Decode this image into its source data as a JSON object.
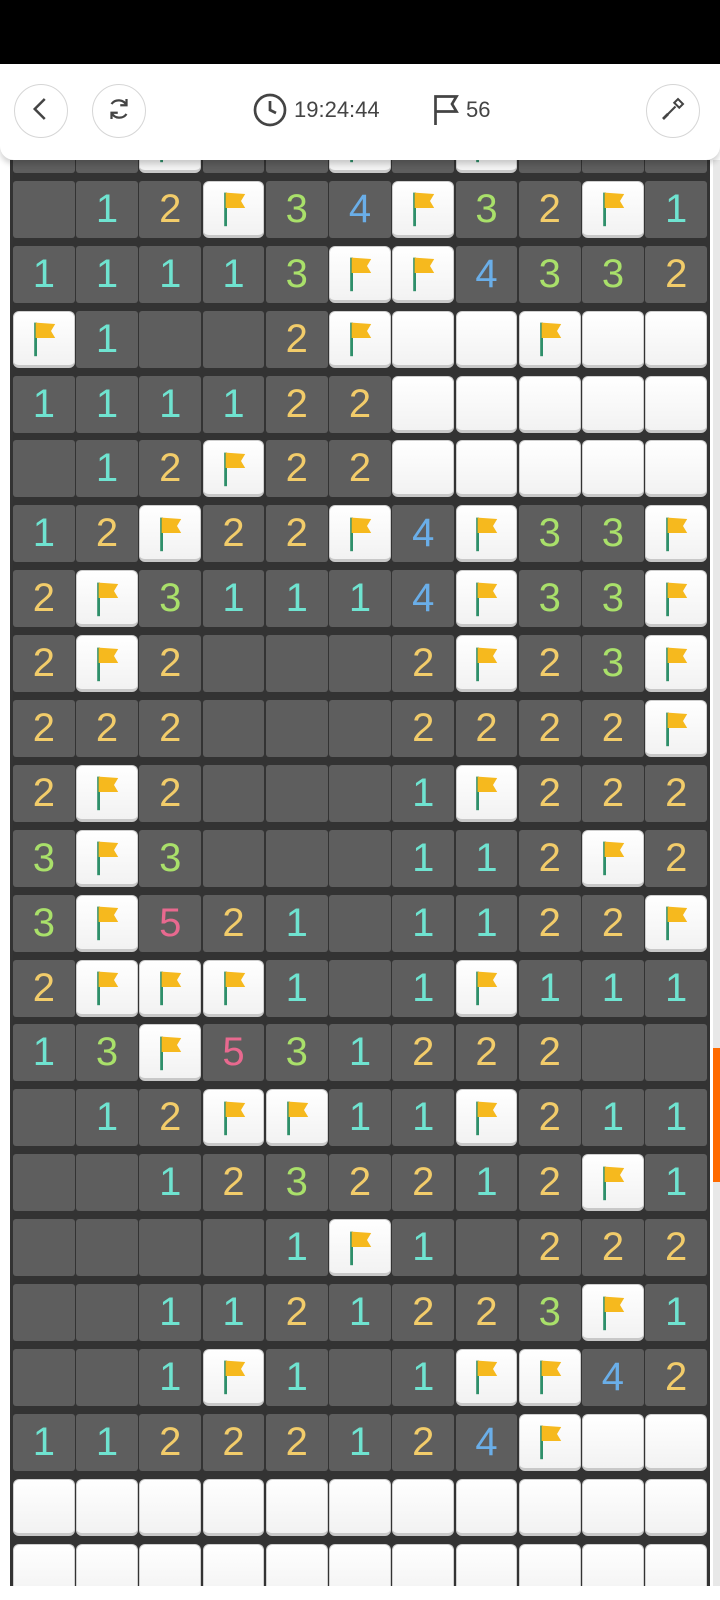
{
  "header": {
    "back_icon": "chevron-left-icon",
    "restart_icon": "refresh-icon",
    "timer": "19:24:44",
    "timer_icon": "clock-icon",
    "flags_remaining": "56",
    "flag_icon": "flag-outline-icon",
    "tool_icon": "shovel-icon"
  },
  "colors": {
    "n1": "#6fe3d0",
    "n2": "#f2cc6a",
    "n3": "#a9e06a",
    "n4": "#6aaee8",
    "n5": "#e8698f",
    "flag": "#f6b91e"
  },
  "board": {
    "cols": 11,
    "rows": [
      [
        "O",
        "O",
        "F",
        "O",
        "O",
        "F",
        "O",
        "F",
        "O",
        "O",
        "O"
      ],
      [
        "O",
        "1",
        "2",
        "F",
        "3",
        "4",
        "F",
        "3",
        "2",
        "F",
        "1"
      ],
      [
        "1",
        "1",
        "1",
        "1",
        "3",
        "F",
        "F",
        "4",
        "3",
        "3",
        "2"
      ],
      [
        "F",
        "1",
        "O",
        "O",
        "2",
        "F",
        "H",
        "H",
        "F",
        "H",
        "H"
      ],
      [
        "1",
        "1",
        "1",
        "1",
        "2",
        "2",
        "H",
        "H",
        "H",
        "H",
        "H"
      ],
      [
        "O",
        "1",
        "2",
        "F",
        "2",
        "2",
        "H",
        "H",
        "H",
        "H",
        "H"
      ],
      [
        "1",
        "2",
        "F",
        "2",
        "2",
        "F",
        "4",
        "F",
        "3",
        "3",
        "F"
      ],
      [
        "2",
        "F",
        "3",
        "1",
        "1",
        "1",
        "4",
        "F",
        "3",
        "3",
        "F"
      ],
      [
        "2",
        "F",
        "2",
        "O",
        "O",
        "O",
        "2",
        "F",
        "2",
        "3",
        "F"
      ],
      [
        "2",
        "2",
        "2",
        "O",
        "O",
        "O",
        "2",
        "2",
        "2",
        "2",
        "F"
      ],
      [
        "2",
        "F",
        "2",
        "O",
        "O",
        "O",
        "1",
        "F",
        "2",
        "2",
        "2"
      ],
      [
        "3",
        "F",
        "3",
        "O",
        "O",
        "O",
        "1",
        "1",
        "2",
        "F",
        "2"
      ],
      [
        "3",
        "F",
        "5",
        "2",
        "1",
        "O",
        "1",
        "1",
        "2",
        "2",
        "F"
      ],
      [
        "2",
        "F",
        "F",
        "F",
        "1",
        "O",
        "1",
        "F",
        "1",
        "1",
        "1"
      ],
      [
        "1",
        "3",
        "F",
        "5",
        "3",
        "1",
        "2",
        "2",
        "2",
        "O",
        "O"
      ],
      [
        "O",
        "1",
        "2",
        "F",
        "F",
        "1",
        "1",
        "F",
        "2",
        "1",
        "1"
      ],
      [
        "O",
        "O",
        "1",
        "2",
        "3",
        "2",
        "2",
        "1",
        "2",
        "F",
        "1"
      ],
      [
        "O",
        "O",
        "O",
        "O",
        "1",
        "F",
        "1",
        "O",
        "2",
        "2",
        "2"
      ],
      [
        "O",
        "O",
        "1",
        "1",
        "2",
        "1",
        "2",
        "2",
        "3",
        "F",
        "1"
      ],
      [
        "O",
        "O",
        "1",
        "F",
        "1",
        "O",
        "1",
        "F",
        "F",
        "4",
        "2"
      ],
      [
        "1",
        "1",
        "2",
        "2",
        "2",
        "1",
        "2",
        "4",
        "F",
        "H",
        "H"
      ],
      [
        "H",
        "H",
        "H",
        "H",
        "H",
        "H",
        "H",
        "H",
        "H",
        "H",
        "H"
      ],
      [
        "H",
        "H",
        "H",
        "H",
        "H",
        "H",
        "H",
        "H",
        "H",
        "H",
        "H"
      ]
    ]
  }
}
